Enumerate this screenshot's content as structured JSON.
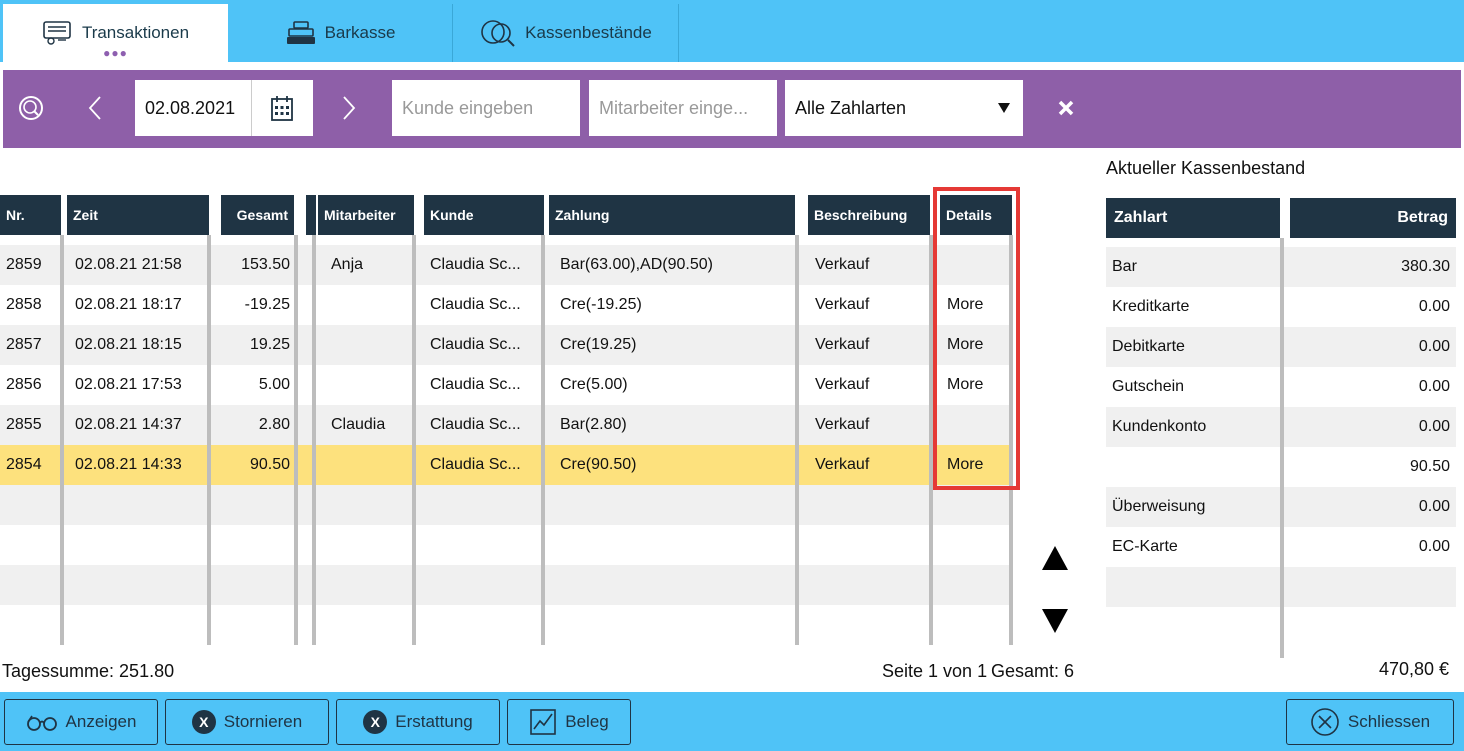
{
  "tabs": [
    {
      "label": "Transaktionen",
      "active": true
    },
    {
      "label": "Barkasse",
      "active": false
    },
    {
      "label": "Kassenbestände",
      "active": false
    }
  ],
  "filter": {
    "date": "02.08.2021",
    "customer_placeholder": "Kunde  eingeben",
    "employee_placeholder": "Mitarbeiter einge...",
    "payment_select": "Alle Zahlarten"
  },
  "table": {
    "headers": [
      "Nr.",
      "Zeit",
      "Gesamt",
      "",
      "Mitarbeiter",
      "Kunde",
      "Zahlung",
      "Beschreibung",
      "Details"
    ],
    "rows": [
      {
        "nr": "2859",
        "zeit": "02.08.21 21:58",
        "gesamt": "153.50",
        "mitarbeiter": "Anja",
        "kunde": "Claudia  Sc...",
        "zahlung": "Bar(63.00),AD(90.50)",
        "beschreibung": "Verkauf",
        "details": ""
      },
      {
        "nr": "2858",
        "zeit": "02.08.21 18:17",
        "gesamt": "-19.25",
        "mitarbeiter": "",
        "kunde": "Claudia  Sc...",
        "zahlung": "Cre(-19.25)",
        "beschreibung": "Verkauf",
        "details": "More"
      },
      {
        "nr": "2857",
        "zeit": "02.08.21 18:15",
        "gesamt": "19.25",
        "mitarbeiter": "",
        "kunde": "Claudia  Sc...",
        "zahlung": "Cre(19.25)",
        "beschreibung": "Verkauf",
        "details": "More"
      },
      {
        "nr": "2856",
        "zeit": "02.08.21 17:53",
        "gesamt": "5.00",
        "mitarbeiter": "",
        "kunde": "Claudia  Sc...",
        "zahlung": "Cre(5.00)",
        "beschreibung": "Verkauf",
        "details": "More"
      },
      {
        "nr": "2855",
        "zeit": "02.08.21 14:37",
        "gesamt": "2.80",
        "mitarbeiter": "Claudia",
        "kunde": "Claudia  Sc...",
        "zahlung": "Bar(2.80)",
        "beschreibung": "Verkauf",
        "details": ""
      },
      {
        "nr": "2854",
        "zeit": "02.08.21 14:33",
        "gesamt": "90.50",
        "mitarbeiter": "",
        "kunde": "Claudia  Sc...",
        "zahlung": "Cre(90.50)",
        "beschreibung": "Verkauf",
        "details": "More",
        "selected": true
      }
    ]
  },
  "footer": {
    "tagessumme": "Tagessumme: 251.80",
    "seite": "Seite 1 von 1",
    "gesamt": "Gesamt: 6",
    "total": "470,80 €"
  },
  "kassenbestand": {
    "title": "Aktueller Kassenbestand",
    "headers": [
      "Zahlart",
      "Betrag"
    ],
    "rows": [
      {
        "zahlart": "Bar",
        "betrag": "380.30"
      },
      {
        "zahlart": "Kreditkarte",
        "betrag": "0.00"
      },
      {
        "zahlart": "Debitkarte",
        "betrag": "0.00"
      },
      {
        "zahlart": "Gutschein",
        "betrag": "0.00"
      },
      {
        "zahlart": "Kundenkonto",
        "betrag": "0.00"
      },
      {
        "zahlart": "",
        "betrag": "90.50"
      },
      {
        "zahlart": "Überweisung",
        "betrag": "0.00"
      },
      {
        "zahlart": "EC-Karte",
        "betrag": "0.00"
      }
    ]
  },
  "actions": {
    "anzeigen": "Anzeigen",
    "stornieren": "Stornieren",
    "erstattung": "Erstattung",
    "beleg": "Beleg",
    "schliessen": "Schliessen"
  },
  "colors": {
    "tabbar": "#4fc3f7",
    "filterbar": "#8e5fa8",
    "header": "#1f3444",
    "selected_row": "#fde17d",
    "highlight": "#e53935"
  }
}
